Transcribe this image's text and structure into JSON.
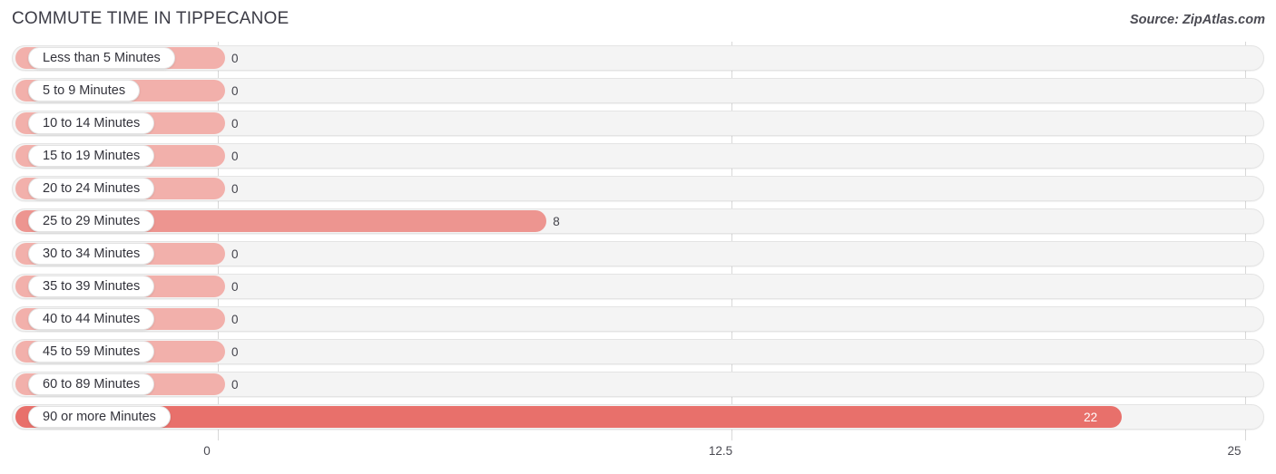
{
  "header": {
    "title": "COMMUTE TIME IN TIPPECANOE",
    "source": "Source: ZipAtlas.com"
  },
  "colors": {
    "bar_low": "#f2b0ab",
    "bar_mid": "#ed9590",
    "bar_high": "#e8706b",
    "track": "#f4f4f4",
    "gridline": "#d8d8d8",
    "text": "#33333b"
  },
  "chart_data": {
    "type": "bar",
    "orientation": "horizontal",
    "title": "COMMUTE TIME IN TIPPECANOE",
    "xlabel": "",
    "ylabel": "",
    "xlim": [
      0,
      25
    ],
    "ticks": [
      "0",
      "12.5",
      "25"
    ],
    "tick_values": [
      0,
      12.5,
      25
    ],
    "grid": true,
    "legend": null,
    "categories": [
      "Less than 5 Minutes",
      "5 to 9 Minutes",
      "10 to 14 Minutes",
      "15 to 19 Minutes",
      "20 to 24 Minutes",
      "25 to 29 Minutes",
      "30 to 34 Minutes",
      "35 to 39 Minutes",
      "40 to 44 Minutes",
      "45 to 59 Minutes",
      "60 to 89 Minutes",
      "90 or more Minutes"
    ],
    "values": [
      0,
      0,
      0,
      0,
      0,
      8,
      0,
      0,
      0,
      0,
      0,
      22
    ],
    "value_labels": [
      "0",
      "0",
      "0",
      "0",
      "0",
      "8",
      "0",
      "0",
      "0",
      "0",
      "0",
      "22"
    ]
  }
}
